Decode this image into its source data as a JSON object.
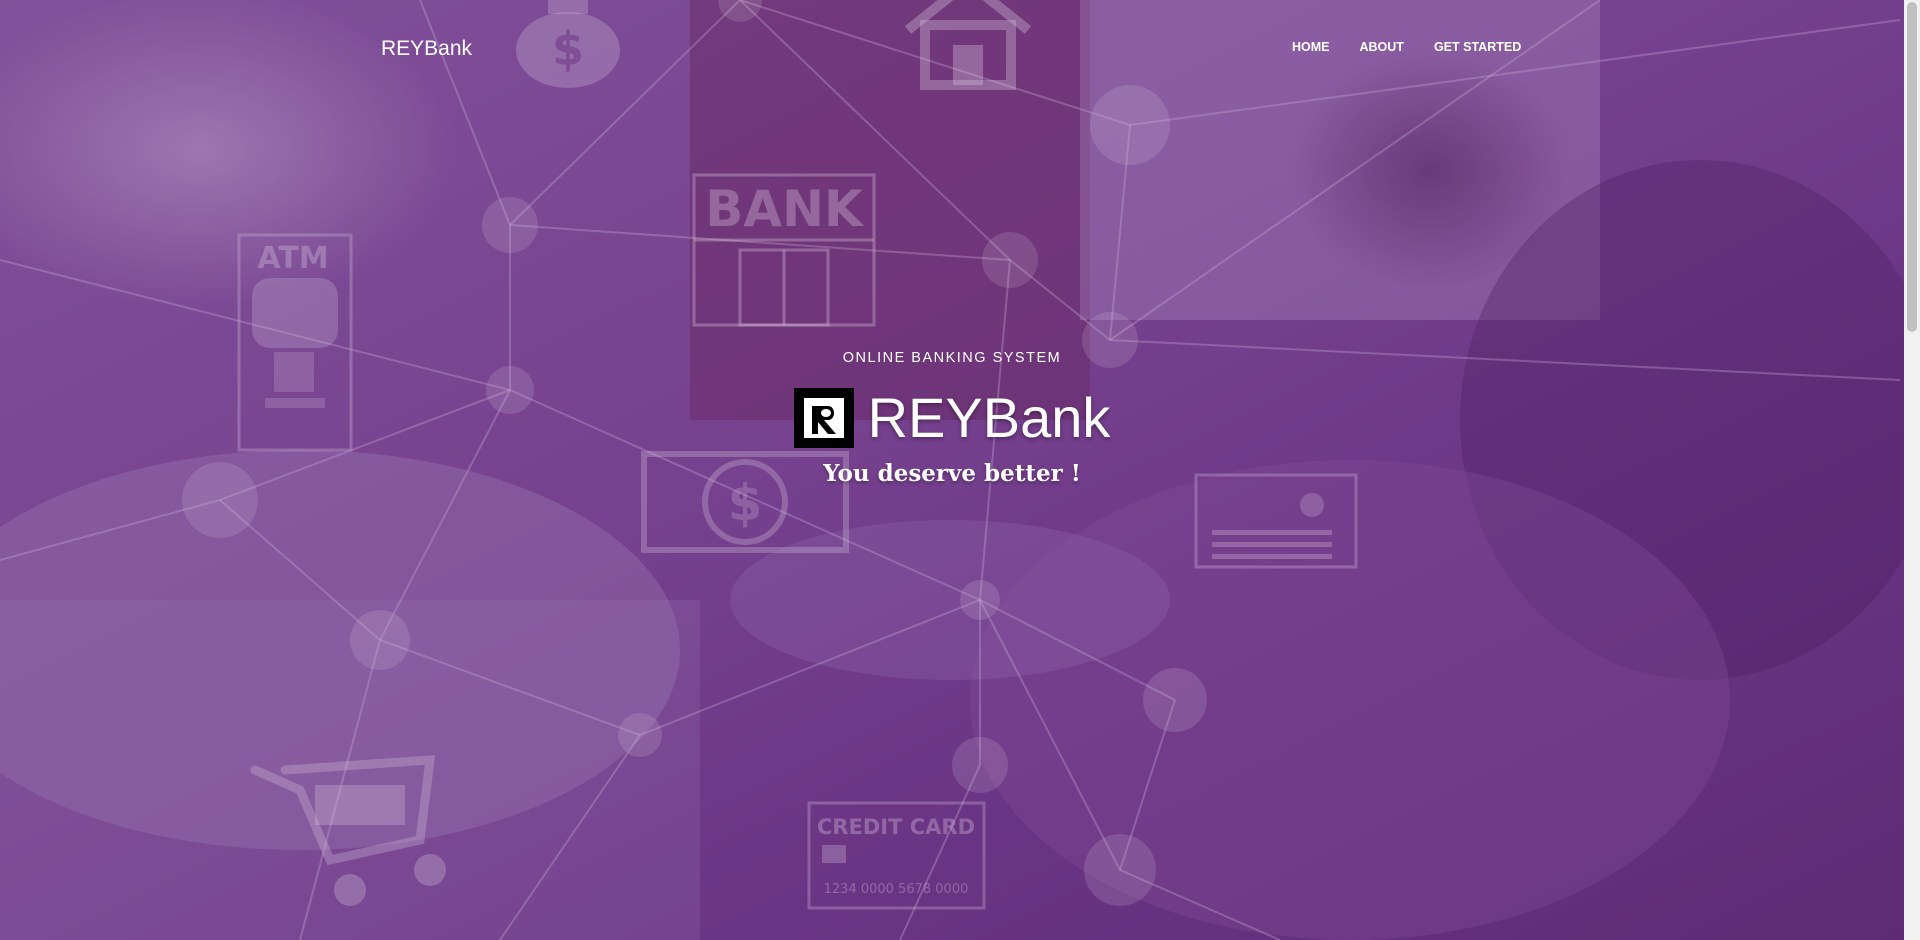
{
  "header": {
    "brand": "REYBank",
    "nav": [
      {
        "label": "HOME"
      },
      {
        "label": "ABOUT"
      },
      {
        "label": "GET STARTED"
      }
    ]
  },
  "hero": {
    "eyebrow": "ONLINE BANKING SYSTEM",
    "title": "REYBank",
    "tagline": "You deserve better !"
  },
  "background": {
    "overlay_color": "#6e3a8c",
    "icons": {
      "bank": "BANK",
      "atm": "ATM",
      "credit_card": "CREDIT CARD",
      "card_number": "1234 0000 5678 0000"
    }
  }
}
